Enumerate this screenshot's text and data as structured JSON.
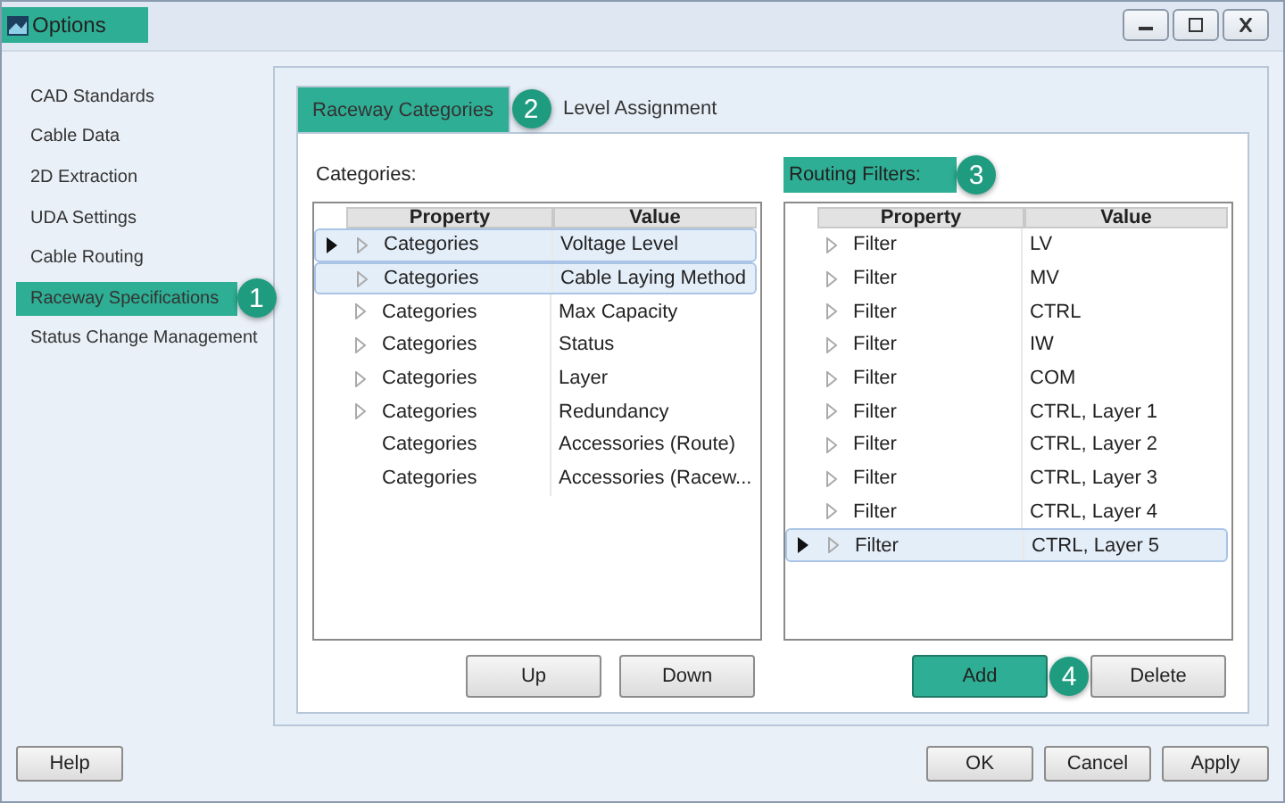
{
  "window": {
    "title": "Options",
    "highlighted": true
  },
  "sidebar": {
    "items": [
      {
        "label": "CAD Standards",
        "selected": false
      },
      {
        "label": "Cable Data",
        "selected": false
      },
      {
        "label": "2D Extraction",
        "selected": false
      },
      {
        "label": "UDA Settings",
        "selected": false
      },
      {
        "label": "Cable Routing",
        "selected": false
      },
      {
        "label": "Raceway Specifications",
        "selected": true,
        "badge": "1"
      },
      {
        "label": "Status Change Management",
        "selected": false
      }
    ]
  },
  "tabs": [
    {
      "label": "Raceway Categories",
      "selected": true,
      "badge": "2"
    },
    {
      "label": "Level Assignment",
      "selected": false
    }
  ],
  "categories": {
    "label": "Categories:",
    "highlighted": false,
    "columns": [
      "Property",
      "Value"
    ],
    "rows": [
      {
        "property": "Categories",
        "value": "Voltage Level",
        "expandable": true,
        "current": true,
        "selected": true
      },
      {
        "property": "Categories",
        "value": "Cable Laying Method",
        "expandable": true,
        "current": false,
        "selected": true
      },
      {
        "property": "Categories",
        "value": "Max Capacity",
        "expandable": true,
        "current": false,
        "selected": false
      },
      {
        "property": "Categories",
        "value": "Status",
        "expandable": true,
        "current": false,
        "selected": false
      },
      {
        "property": "Categories",
        "value": "Layer",
        "expandable": true,
        "current": false,
        "selected": false
      },
      {
        "property": "Categories",
        "value": "Redundancy",
        "expandable": true,
        "current": false,
        "selected": false
      },
      {
        "property": "Categories",
        "value": "Accessories (Route)",
        "expandable": false,
        "current": false,
        "selected": false
      },
      {
        "property": "Categories",
        "value": "Accessories (Racew...",
        "expandable": false,
        "current": false,
        "selected": false
      }
    ],
    "buttons": [
      {
        "label": "Up",
        "highlighted": false
      },
      {
        "label": "Down",
        "highlighted": false
      }
    ]
  },
  "routing_filters": {
    "label": "Routing Filters:",
    "highlighted": true,
    "badge": "3",
    "columns": [
      "Property",
      "Value"
    ],
    "rows": [
      {
        "property": "Filter",
        "value": "LV",
        "expandable": true,
        "current": false,
        "selected": false
      },
      {
        "property": "Filter",
        "value": "MV",
        "expandable": true,
        "current": false,
        "selected": false
      },
      {
        "property": "Filter",
        "value": "CTRL",
        "expandable": true,
        "current": false,
        "selected": false
      },
      {
        "property": "Filter",
        "value": "IW",
        "expandable": true,
        "current": false,
        "selected": false
      },
      {
        "property": "Filter",
        "value": "COM",
        "expandable": true,
        "current": false,
        "selected": false
      },
      {
        "property": "Filter",
        "value": "CTRL, Layer 1",
        "expandable": true,
        "current": false,
        "selected": false
      },
      {
        "property": "Filter",
        "value": "CTRL, Layer 2",
        "expandable": true,
        "current": false,
        "selected": false
      },
      {
        "property": "Filter",
        "value": "CTRL, Layer 3",
        "expandable": true,
        "current": false,
        "selected": false
      },
      {
        "property": "Filter",
        "value": "CTRL, Layer 4",
        "expandable": true,
        "current": false,
        "selected": false
      },
      {
        "property": "Filter",
        "value": "CTRL, Layer 5",
        "expandable": true,
        "current": true,
        "selected": true
      }
    ],
    "buttons": [
      {
        "label": "Add",
        "highlighted": true,
        "badge": "4"
      },
      {
        "label": "Delete",
        "highlighted": false
      }
    ]
  },
  "footer": {
    "help": "Help",
    "buttons": [
      "OK",
      "Cancel",
      "Apply"
    ]
  }
}
